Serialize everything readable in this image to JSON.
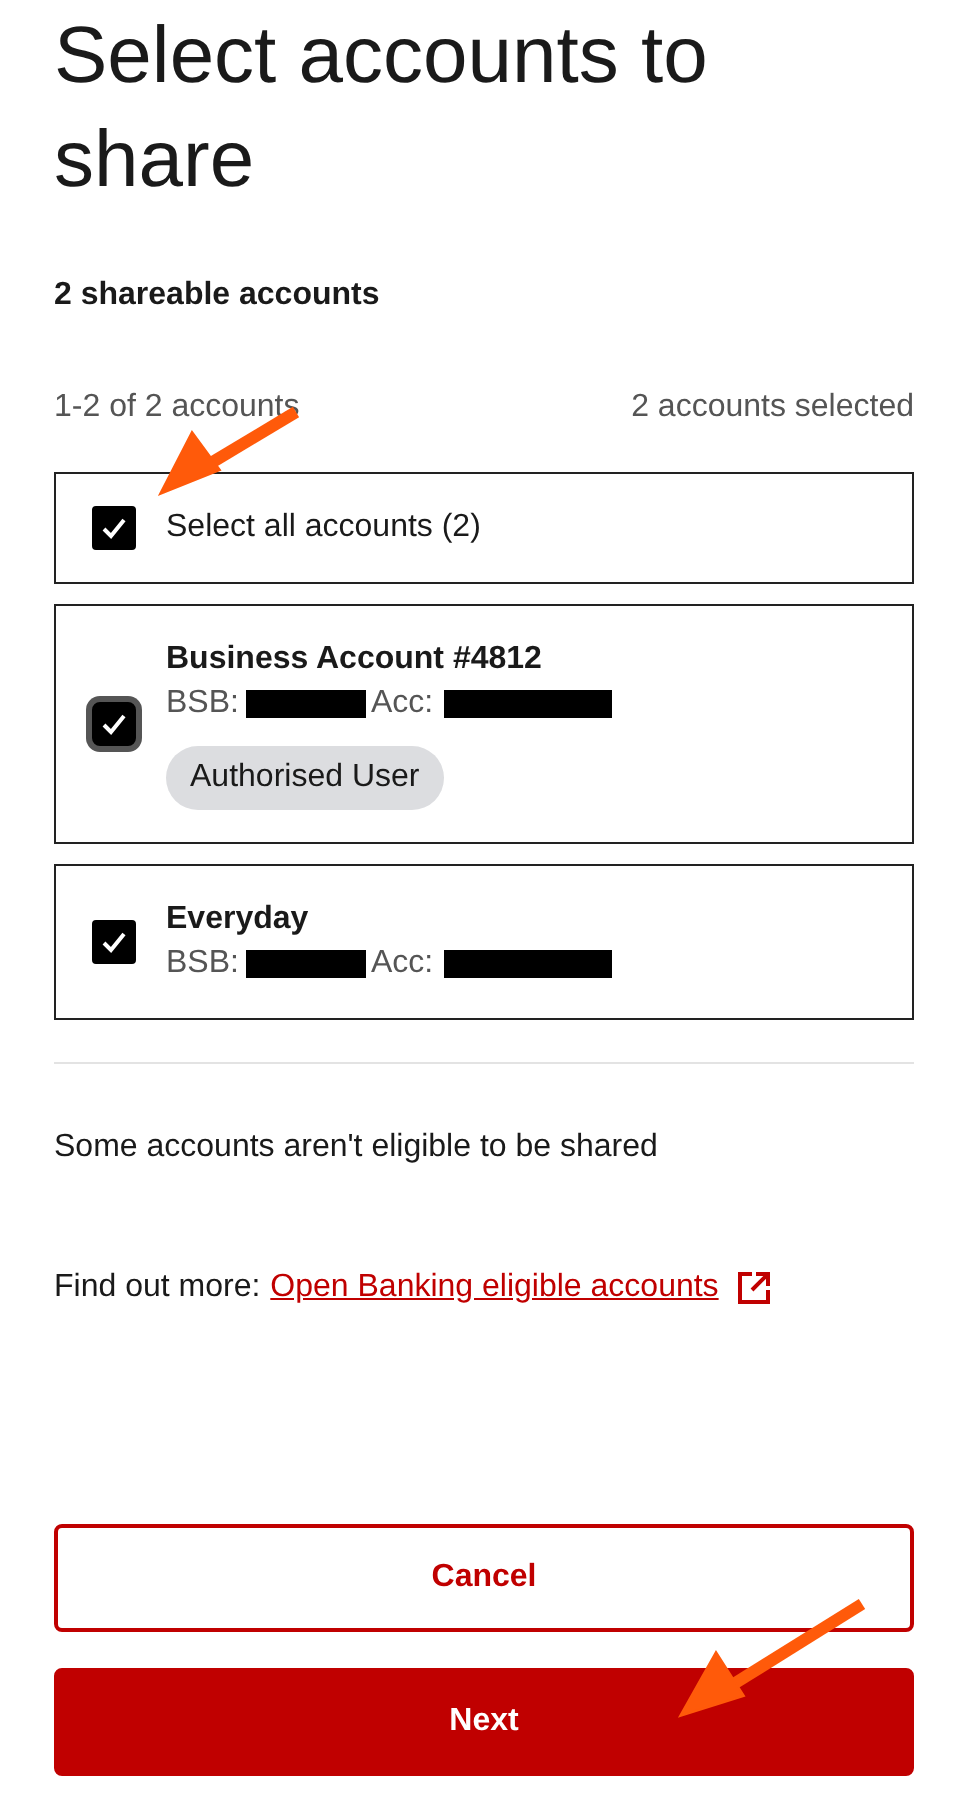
{
  "title": "Select accounts to share",
  "subtitle": "2 shareable accounts",
  "range": "1-2 of 2 accounts",
  "selected_count": "2 accounts selected",
  "select_all": {
    "label": "Select all accounts (2)",
    "checked": true
  },
  "accounts": [
    {
      "name": "Business Account #4812",
      "bsb_label": "BSB:",
      "acc_label": "Acc:",
      "badge": "Authorised User",
      "checked": true,
      "focused": true
    },
    {
      "name": "Everyday",
      "bsb_label": "BSB:",
      "acc_label": "Acc:",
      "checked": true,
      "focused": false
    }
  ],
  "ineligible_note": "Some accounts aren't eligible to be shared",
  "more": {
    "prefix": "Find out more:",
    "link": "Open Banking eligible accounts"
  },
  "buttons": [
    {
      "label": "Cancel",
      "kind": "secondary"
    },
    {
      "label": "Next",
      "kind": "primary"
    }
  ]
}
